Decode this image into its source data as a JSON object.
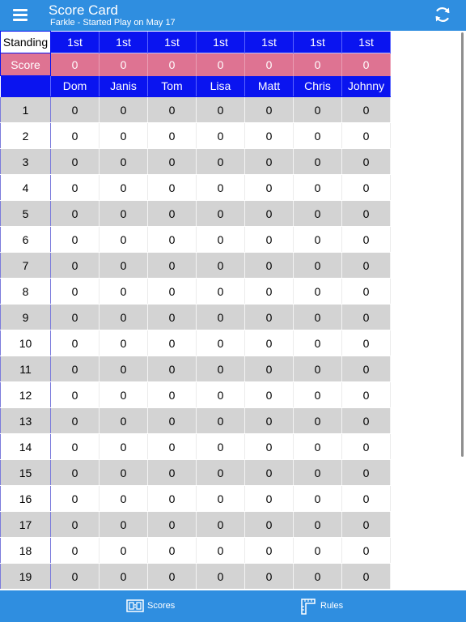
{
  "header": {
    "title": "Score Card",
    "subtitle": "Farkle - Started Play on May 17"
  },
  "labels": {
    "standing": "Standing",
    "score": "Score"
  },
  "players": [
    {
      "name": "Dom",
      "standing": "1st",
      "score": "0"
    },
    {
      "name": "Janis",
      "standing": "1st",
      "score": "0"
    },
    {
      "name": "Tom",
      "standing": "1st",
      "score": "0"
    },
    {
      "name": "Lisa",
      "standing": "1st",
      "score": "0"
    },
    {
      "name": "Matt",
      "standing": "1st",
      "score": "0"
    },
    {
      "name": "Chris",
      "standing": "1st",
      "score": "0"
    },
    {
      "name": "Johnny",
      "standing": "1st",
      "score": "0"
    }
  ],
  "rounds": [
    {
      "number": "1",
      "scores": [
        "0",
        "0",
        "0",
        "0",
        "0",
        "0",
        "0"
      ]
    },
    {
      "number": "2",
      "scores": [
        "0",
        "0",
        "0",
        "0",
        "0",
        "0",
        "0"
      ]
    },
    {
      "number": "3",
      "scores": [
        "0",
        "0",
        "0",
        "0",
        "0",
        "0",
        "0"
      ]
    },
    {
      "number": "4",
      "scores": [
        "0",
        "0",
        "0",
        "0",
        "0",
        "0",
        "0"
      ]
    },
    {
      "number": "5",
      "scores": [
        "0",
        "0",
        "0",
        "0",
        "0",
        "0",
        "0"
      ]
    },
    {
      "number": "6",
      "scores": [
        "0",
        "0",
        "0",
        "0",
        "0",
        "0",
        "0"
      ]
    },
    {
      "number": "7",
      "scores": [
        "0",
        "0",
        "0",
        "0",
        "0",
        "0",
        "0"
      ]
    },
    {
      "number": "8",
      "scores": [
        "0",
        "0",
        "0",
        "0",
        "0",
        "0",
        "0"
      ]
    },
    {
      "number": "9",
      "scores": [
        "0",
        "0",
        "0",
        "0",
        "0",
        "0",
        "0"
      ]
    },
    {
      "number": "10",
      "scores": [
        "0",
        "0",
        "0",
        "0",
        "0",
        "0",
        "0"
      ]
    },
    {
      "number": "11",
      "scores": [
        "0",
        "0",
        "0",
        "0",
        "0",
        "0",
        "0"
      ]
    },
    {
      "number": "12",
      "scores": [
        "0",
        "0",
        "0",
        "0",
        "0",
        "0",
        "0"
      ]
    },
    {
      "number": "13",
      "scores": [
        "0",
        "0",
        "0",
        "0",
        "0",
        "0",
        "0"
      ]
    },
    {
      "number": "14",
      "scores": [
        "0",
        "0",
        "0",
        "0",
        "0",
        "0",
        "0"
      ]
    },
    {
      "number": "15",
      "scores": [
        "0",
        "0",
        "0",
        "0",
        "0",
        "0",
        "0"
      ]
    },
    {
      "number": "16",
      "scores": [
        "0",
        "0",
        "0",
        "0",
        "0",
        "0",
        "0"
      ]
    },
    {
      "number": "17",
      "scores": [
        "0",
        "0",
        "0",
        "0",
        "0",
        "0",
        "0"
      ]
    },
    {
      "number": "18",
      "scores": [
        "0",
        "0",
        "0",
        "0",
        "0",
        "0",
        "0"
      ]
    },
    {
      "number": "19",
      "scores": [
        "0",
        "0",
        "0",
        "0",
        "0",
        "0",
        "0"
      ]
    }
  ],
  "tabbar": {
    "scores_label": "Scores",
    "rules_label": "Rules"
  },
  "icons": {
    "menu": "hamburger-menu-icon",
    "refresh": "refresh-icon",
    "scores": "scoreboard-icon",
    "rules": "ruler-icon"
  },
  "colors": {
    "header": "#2f8ee0",
    "standing_row": "#0a14f0",
    "score_row": "#de7392",
    "alt_row": "#d3d3d3"
  }
}
